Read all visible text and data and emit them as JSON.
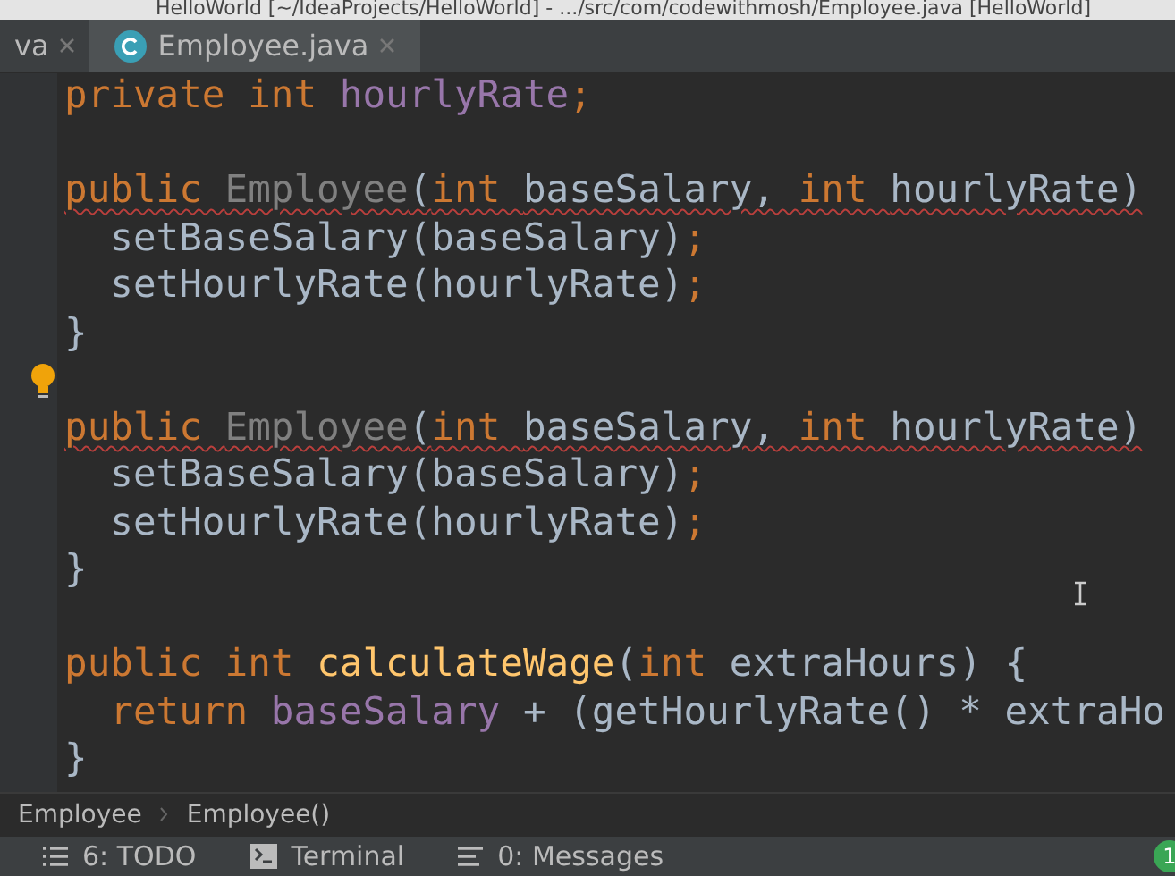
{
  "window": {
    "title": "HelloWorld [~/IdeaProjects/HelloWorld] - .../src/com/codewithmosh/Employee.java [HelloWorld]"
  },
  "tabs": [
    {
      "label": "va",
      "selected": false
    },
    {
      "label": "Employee.java",
      "selected": true
    }
  ],
  "editor": {
    "lines": [
      {
        "error": false,
        "tokens": [
          {
            "kind": "keyword",
            "text": "private "
          },
          {
            "kind": "keyword",
            "text": "int "
          },
          {
            "kind": "field",
            "text": "hourlyRate"
          },
          {
            "kind": "keyword",
            "text": ";"
          }
        ]
      },
      {
        "kind": "blank"
      },
      {
        "error": true,
        "tokens": [
          {
            "kind": "keyword",
            "text": "public "
          },
          {
            "kind": "unused",
            "text": "Employee"
          },
          {
            "kind": "plain",
            "text": "("
          },
          {
            "kind": "keyword",
            "text": "int "
          },
          {
            "kind": "plain",
            "text": "baseSalary, "
          },
          {
            "kind": "keyword",
            "text": "int "
          },
          {
            "kind": "plain",
            "text": "hourlyRate)"
          }
        ]
      },
      {
        "error": false,
        "tokens": [
          {
            "kind": "plain",
            "text": "  setBaseSalary(baseSalary)"
          },
          {
            "kind": "keyword",
            "text": ";"
          }
        ]
      },
      {
        "error": false,
        "tokens": [
          {
            "kind": "plain",
            "text": "  setHourlyRate(hourlyRate)"
          },
          {
            "kind": "keyword",
            "text": ";"
          }
        ]
      },
      {
        "error": false,
        "tokens": [
          {
            "kind": "plain",
            "text": "}"
          }
        ]
      },
      {
        "kind": "hint"
      },
      {
        "error": true,
        "tokens": [
          {
            "kind": "keyword",
            "text": "public "
          },
          {
            "kind": "unused",
            "text": "Employee"
          },
          {
            "kind": "plain",
            "text": "("
          },
          {
            "kind": "keyword",
            "text": "int "
          },
          {
            "kind": "plain",
            "text": "baseSalary, "
          },
          {
            "kind": "keyword",
            "text": "int "
          },
          {
            "kind": "plain",
            "text": "hourlyRate)"
          }
        ]
      },
      {
        "error": false,
        "tokens": [
          {
            "kind": "plain",
            "text": "  setBaseSalary(baseSalary)"
          },
          {
            "kind": "keyword",
            "text": ";"
          }
        ]
      },
      {
        "error": false,
        "tokens": [
          {
            "kind": "plain",
            "text": "  setHourlyRate(hourlyRate)"
          },
          {
            "kind": "keyword",
            "text": ";"
          }
        ]
      },
      {
        "error": false,
        "tokens": [
          {
            "kind": "plain",
            "text": "}"
          }
        ]
      },
      {
        "kind": "blank"
      },
      {
        "error": false,
        "tokens": [
          {
            "kind": "keyword",
            "text": "public "
          },
          {
            "kind": "keyword",
            "text": "int "
          },
          {
            "kind": "method",
            "text": "calculateWage"
          },
          {
            "kind": "plain",
            "text": "("
          },
          {
            "kind": "keyword",
            "text": "int "
          },
          {
            "kind": "plain",
            "text": "extraHours) {"
          }
        ]
      },
      {
        "error": false,
        "tokens": [
          {
            "kind": "keyword",
            "text": "  return "
          },
          {
            "kind": "field",
            "text": "baseSalary "
          },
          {
            "kind": "plain",
            "text": "+ (getHourlyRate() * extraHo"
          }
        ]
      },
      {
        "error": false,
        "tokens": [
          {
            "kind": "plain",
            "text": "}"
          }
        ]
      }
    ]
  },
  "breadcrumbs": [
    "Employee",
    "Employee()"
  ],
  "status_bar": {
    "tools": [
      {
        "kind": "list",
        "label": "6: TODO"
      },
      {
        "kind": "terminal",
        "label": "Terminal"
      },
      {
        "kind": "messages",
        "label": "0: Messages"
      }
    ],
    "badge": "1"
  }
}
